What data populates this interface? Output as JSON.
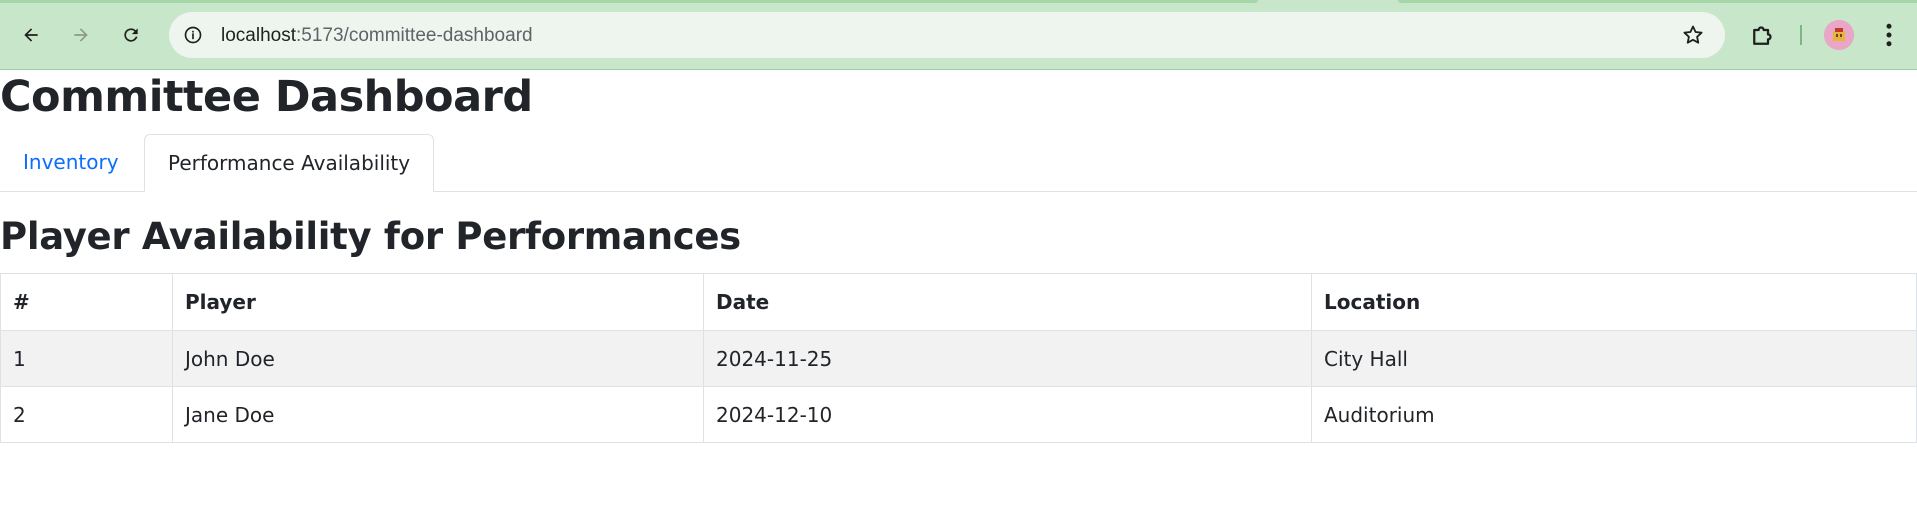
{
  "browser": {
    "url_host": "localhost",
    "url_path": ":5173/committee-dashboard",
    "icons": {
      "back": "arrow-left-icon",
      "forward": "arrow-right-icon",
      "reload": "reload-icon",
      "site_info": "info-icon",
      "bookmark": "star-icon",
      "extensions": "puzzle-icon",
      "profile": "avatar",
      "menu": "kebab-menu-icon"
    },
    "colors": {
      "frame": "#c8e6c9",
      "omnibox": "#eef5ee"
    }
  },
  "page": {
    "title": "Committee Dashboard",
    "tabs": [
      {
        "label": "Inventory",
        "active": false
      },
      {
        "label": "Performance Availability",
        "active": true
      }
    ],
    "section_title": "Player Availability for Performances",
    "table": {
      "headers": [
        "#",
        "Player",
        "Date",
        "Location"
      ],
      "rows": [
        [
          "1",
          "John Doe",
          "2024-11-25",
          "City Hall"
        ],
        [
          "2",
          "Jane Doe",
          "2024-12-10",
          "Auditorium"
        ]
      ]
    },
    "colors": {
      "link": "#0d6efd",
      "stripe": "#f2f2f2",
      "border": "#dee2e6",
      "text": "#212529"
    }
  }
}
